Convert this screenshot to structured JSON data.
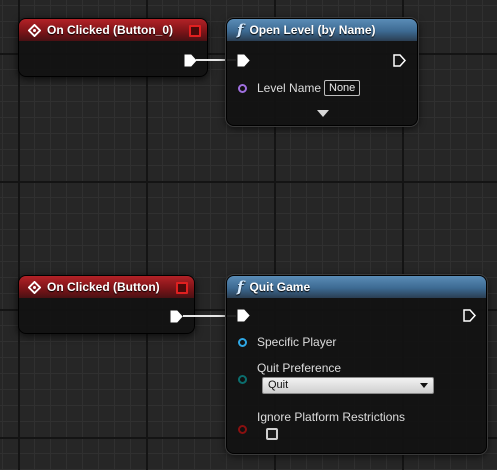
{
  "nodes": {
    "on_clicked_button_0": {
      "title": "On Clicked (Button_0)"
    },
    "open_level": {
      "title": "Open Level (by Name)",
      "level_name_label": "Level Name",
      "level_name_value": "None"
    },
    "on_clicked_button": {
      "title": "On Clicked (Button)"
    },
    "quit_game": {
      "title": "Quit Game",
      "specific_player_label": "Specific Player",
      "quit_preference_label": "Quit Preference",
      "quit_preference_value": "Quit",
      "ignore_platform_label": "Ignore Platform Restrictions",
      "ignore_platform_checked": false
    }
  },
  "colors": {
    "event_header": "#b32227",
    "function_header": "#3d6a92",
    "pin_object": "#a070e0",
    "pin_player": "#2fa8e6",
    "pin_enum": "#0b6e6e",
    "pin_bool": "#8a1010",
    "exec_wire": "#e8e8e8"
  }
}
